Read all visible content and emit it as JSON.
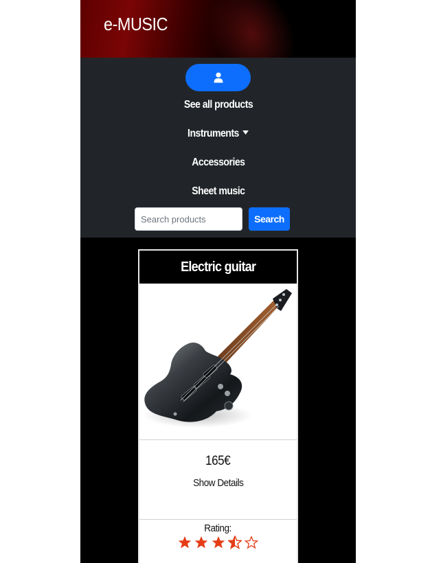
{
  "brand": "e-MUSIC",
  "nav": {
    "user_icon": "user-icon",
    "see_all": "See all products",
    "instruments": "Instruments",
    "accessories": "Accessories",
    "sheet_music": "Sheet music"
  },
  "search": {
    "placeholder": "Search products",
    "value": "",
    "button_label": "Search"
  },
  "product": {
    "name": "Electric guitar",
    "image": "electric-guitar-image",
    "price": "165€",
    "details_link": "Show Details",
    "rating_label": "Rating:",
    "rating_value": 3.5,
    "rating_max": 5
  },
  "colors": {
    "accent": "#0d6efd",
    "navbar": "#212529",
    "star": "#e53d17"
  }
}
